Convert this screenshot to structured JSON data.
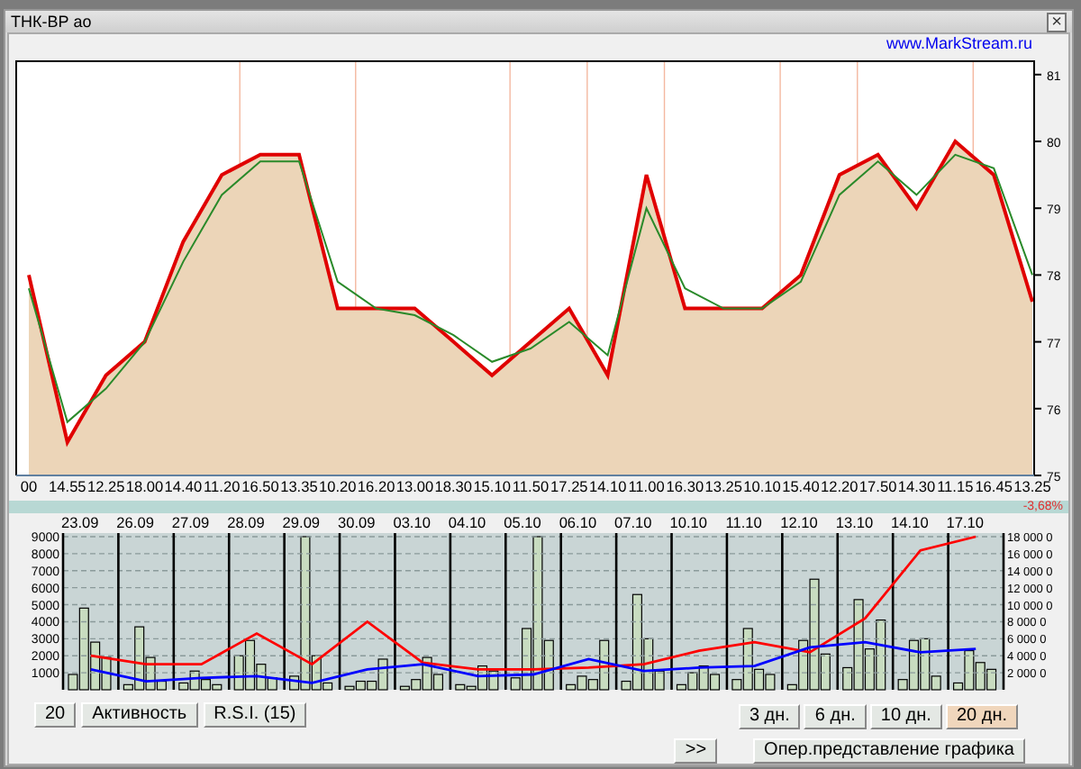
{
  "window": {
    "title": "ТНК-ВР ао",
    "close_button": "×"
  },
  "website_link": "www.MarkStream.ru",
  "price_chart": {
    "chart_data": {
      "type": "area",
      "categories": [
        "00",
        "14.55",
        "12.25",
        "18.00",
        "14.40",
        "11.20",
        "16.50",
        "13.35",
        "10.20",
        "16.20",
        "13.00",
        "18.30",
        "15.10",
        "11.50",
        "17.25",
        "14.10",
        "11.00",
        "16.30",
        "13.25",
        "10.10",
        "15.40",
        "12.20",
        "17.50",
        "14.30",
        "11.15",
        "16.45",
        "13.25"
      ],
      "ylim": [
        75,
        81.2
      ],
      "yticks": [
        75,
        76,
        77,
        78,
        79,
        80,
        81
      ],
      "series": [
        {
          "color": "#e00000",
          "values": [
            78,
            75.5,
            76.5,
            77,
            78.5,
            79.5,
            79.8,
            79.8,
            77.5,
            77.5,
            77.5,
            77,
            76.5,
            77,
            77.5,
            76.5,
            79.5,
            77.5,
            77.5,
            77.5,
            78,
            79.5,
            79.8,
            79,
            80,
            79.5,
            77.6
          ]
        },
        {
          "color": "#2a8a2a",
          "type": "line",
          "values": [
            77.8,
            75.8,
            76.3,
            77,
            78.2,
            79.2,
            79.7,
            79.7,
            77.9,
            77.5,
            77.4,
            77.1,
            76.7,
            76.9,
            77.3,
            76.8,
            79,
            77.8,
            77.5,
            77.5,
            77.9,
            79.2,
            79.7,
            79.2,
            79.8,
            79.6,
            78
          ]
        }
      ]
    }
  },
  "change": "-3,68%",
  "activity_chart": {
    "chart_data": {
      "type": "line",
      "grid": true,
      "categories": [
        "23.09",
        "26.09",
        "27.09",
        "28.09",
        "29.09",
        "30.09",
        "03.10",
        "04.10",
        "05.10",
        "06.10",
        "07.10",
        "10.10",
        "11.10",
        "12.10",
        "13.10",
        "14.10",
        "17.10"
      ],
      "ylim": [
        0,
        9000
      ],
      "yticks": [
        {
          "value": 1000,
          "label": "1000"
        },
        {
          "value": 2000,
          "label": "2000"
        },
        {
          "value": 3000,
          "label": "3000"
        },
        {
          "value": 4000,
          "label": "4000"
        },
        {
          "value": 5000,
          "label": "5000"
        },
        {
          "value": 6000,
          "label": "6000"
        },
        {
          "value": 7000,
          "label": "7000"
        },
        {
          "value": 8000,
          "label": "8000"
        },
        {
          "value": 9000,
          "label": "9000"
        }
      ],
      "series": [
        {
          "color": "#ff0000",
          "values": [
            2000,
            1500,
            1500,
            3300,
            1500,
            4000,
            1600,
            1200,
            1200,
            1300,
            1500,
            2300,
            2800,
            2200,
            4200,
            8200,
            9000
          ]
        },
        {
          "color": "#0000ff",
          "values": [
            1200,
            500,
            700,
            800,
            400,
            1200,
            1500,
            800,
            900,
            1800,
            1100,
            1300,
            1400,
            2500,
            2800,
            2200,
            2400
          ]
        }
      ]
    },
    "right_axis_ticks": [
      "18 000 0",
      "16 000 0",
      "14 000 0",
      "12 000 0",
      "10 000 0",
      "8 000 0",
      "6 000 0",
      "4 000 0",
      "2 000 0"
    ]
  },
  "left_buttons": [
    {
      "label": "20"
    },
    {
      "label": "Активность"
    },
    {
      "label": "R.S.I.  (15)"
    }
  ],
  "period_tabs": [
    {
      "label": "3 дн.",
      "selected": false
    },
    {
      "label": "6 дн.",
      "selected": false
    },
    {
      "label": "10 дн.",
      "selected": false
    },
    {
      "label": "20 дн.",
      "selected": true
    }
  ],
  "scroll_button": ">>",
  "view_button": "Опер.представление графика"
}
